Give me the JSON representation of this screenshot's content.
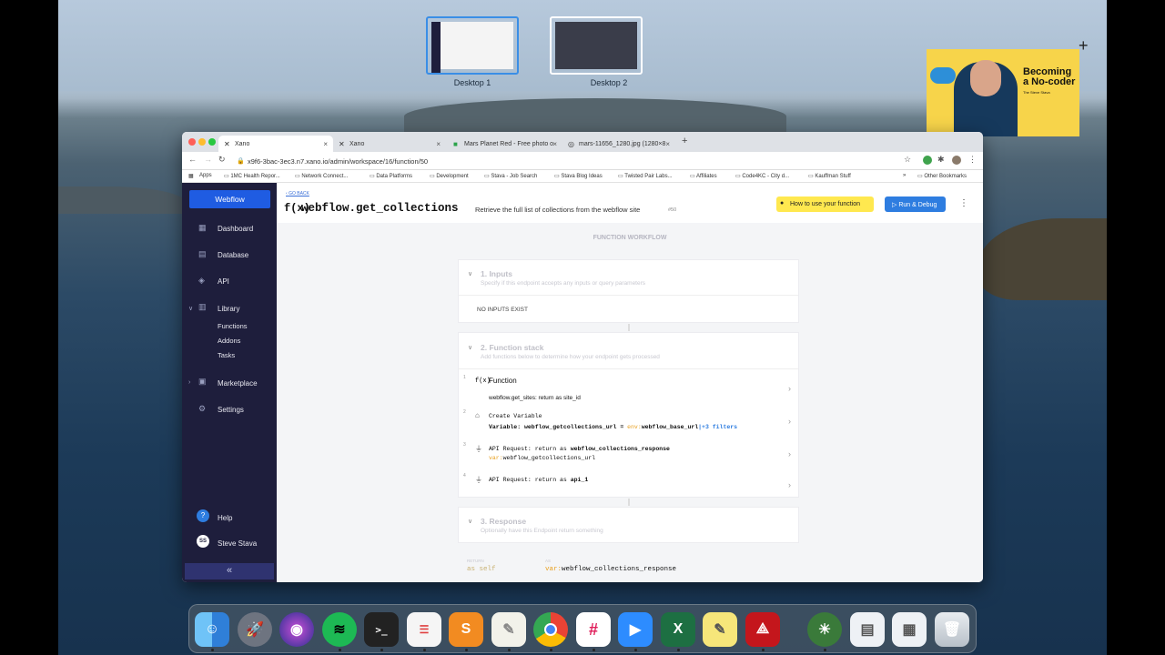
{
  "desktops": [
    {
      "label": "Desktop 1"
    },
    {
      "label": "Desktop 2"
    }
  ],
  "video": {
    "title_line1": "Becoming",
    "title_line2": "a No-coder",
    "subtitle": "The Steve Stava"
  },
  "browser": {
    "tabs": [
      {
        "label": "Xano"
      },
      {
        "label": "Xano"
      },
      {
        "label": "Mars Planet Red - Free photo o"
      },
      {
        "label": "mars-11656_1280.jpg (1280×8"
      }
    ],
    "url": "x9f6-3bac-3ec3.n7.xano.io/admin/workspace/16/function/50",
    "bookmarks": [
      "Apps",
      "1MC Health Repor...",
      "Network Connect...",
      "Data Platforms",
      "Development",
      "Stava - Job Search",
      "Stava Blog Ideas",
      "Twisted Pair Labs...",
      "Affiliates",
      "Code4KC - City d...",
      "Kauffman Stuff",
      "»",
      "Other Bookmarks"
    ]
  },
  "sidebar": {
    "workspace": "Webflow",
    "items": [
      {
        "label": "Dashboard"
      },
      {
        "label": "Database"
      },
      {
        "label": "API"
      },
      {
        "label": "Library"
      }
    ],
    "library_items": [
      {
        "label": "Functions"
      },
      {
        "label": "Addons"
      },
      {
        "label": "Tasks"
      }
    ],
    "items2": [
      {
        "label": "Marketplace"
      },
      {
        "label": "Settings"
      }
    ],
    "help": "Help",
    "user": {
      "initials": "SS",
      "name": "Steve Stava"
    },
    "collapse": "«"
  },
  "header": {
    "go_back": "GO BACK",
    "fn_icon": "f(x)",
    "title": "webflow.get_collections",
    "description": "Retrieve the full list of collections from the webflow site",
    "id": "#50",
    "howto": "How to use your function",
    "run": "Run & Debug",
    "more": "⋮"
  },
  "workflow": {
    "label": "FUNCTION WORKFLOW",
    "inputs": {
      "title": "1. Inputs",
      "desc": "Specify if this endpoint accepts any inputs or query parameters",
      "empty": "NO INPUTS EXIST"
    },
    "stack": {
      "title": "2. Function stack",
      "desc": "Add functions below to determine how your endpoint gets processed",
      "steps": [
        {
          "num": "1",
          "icon": "f(x)",
          "name": "Function",
          "detail": "webflow.get_sites: return as site_id"
        },
        {
          "num": "2",
          "name": "Create Variable",
          "detail_prefix": "Variable: webflow_getcollections_url = ",
          "detail_env": "env:",
          "detail_var": "webflow_base_url",
          "detail_filters": "|+3 filters"
        },
        {
          "num": "3",
          "name_prefix": "API Request: return as ",
          "name_bold": "webflow_collections_response",
          "detail_var": "var:",
          "detail": "webflow_getcollections_url"
        },
        {
          "num": "4",
          "name_prefix": "API Request: return as ",
          "name_bold": "api_1"
        }
      ]
    },
    "response": {
      "title": "3. Response",
      "desc": "Optionally have this Endpoint return something",
      "return_label": "RETURN",
      "as_label": "AS",
      "return_value": "as self",
      "as_var": "var:",
      "as_value": "webflow_collections_response"
    }
  }
}
